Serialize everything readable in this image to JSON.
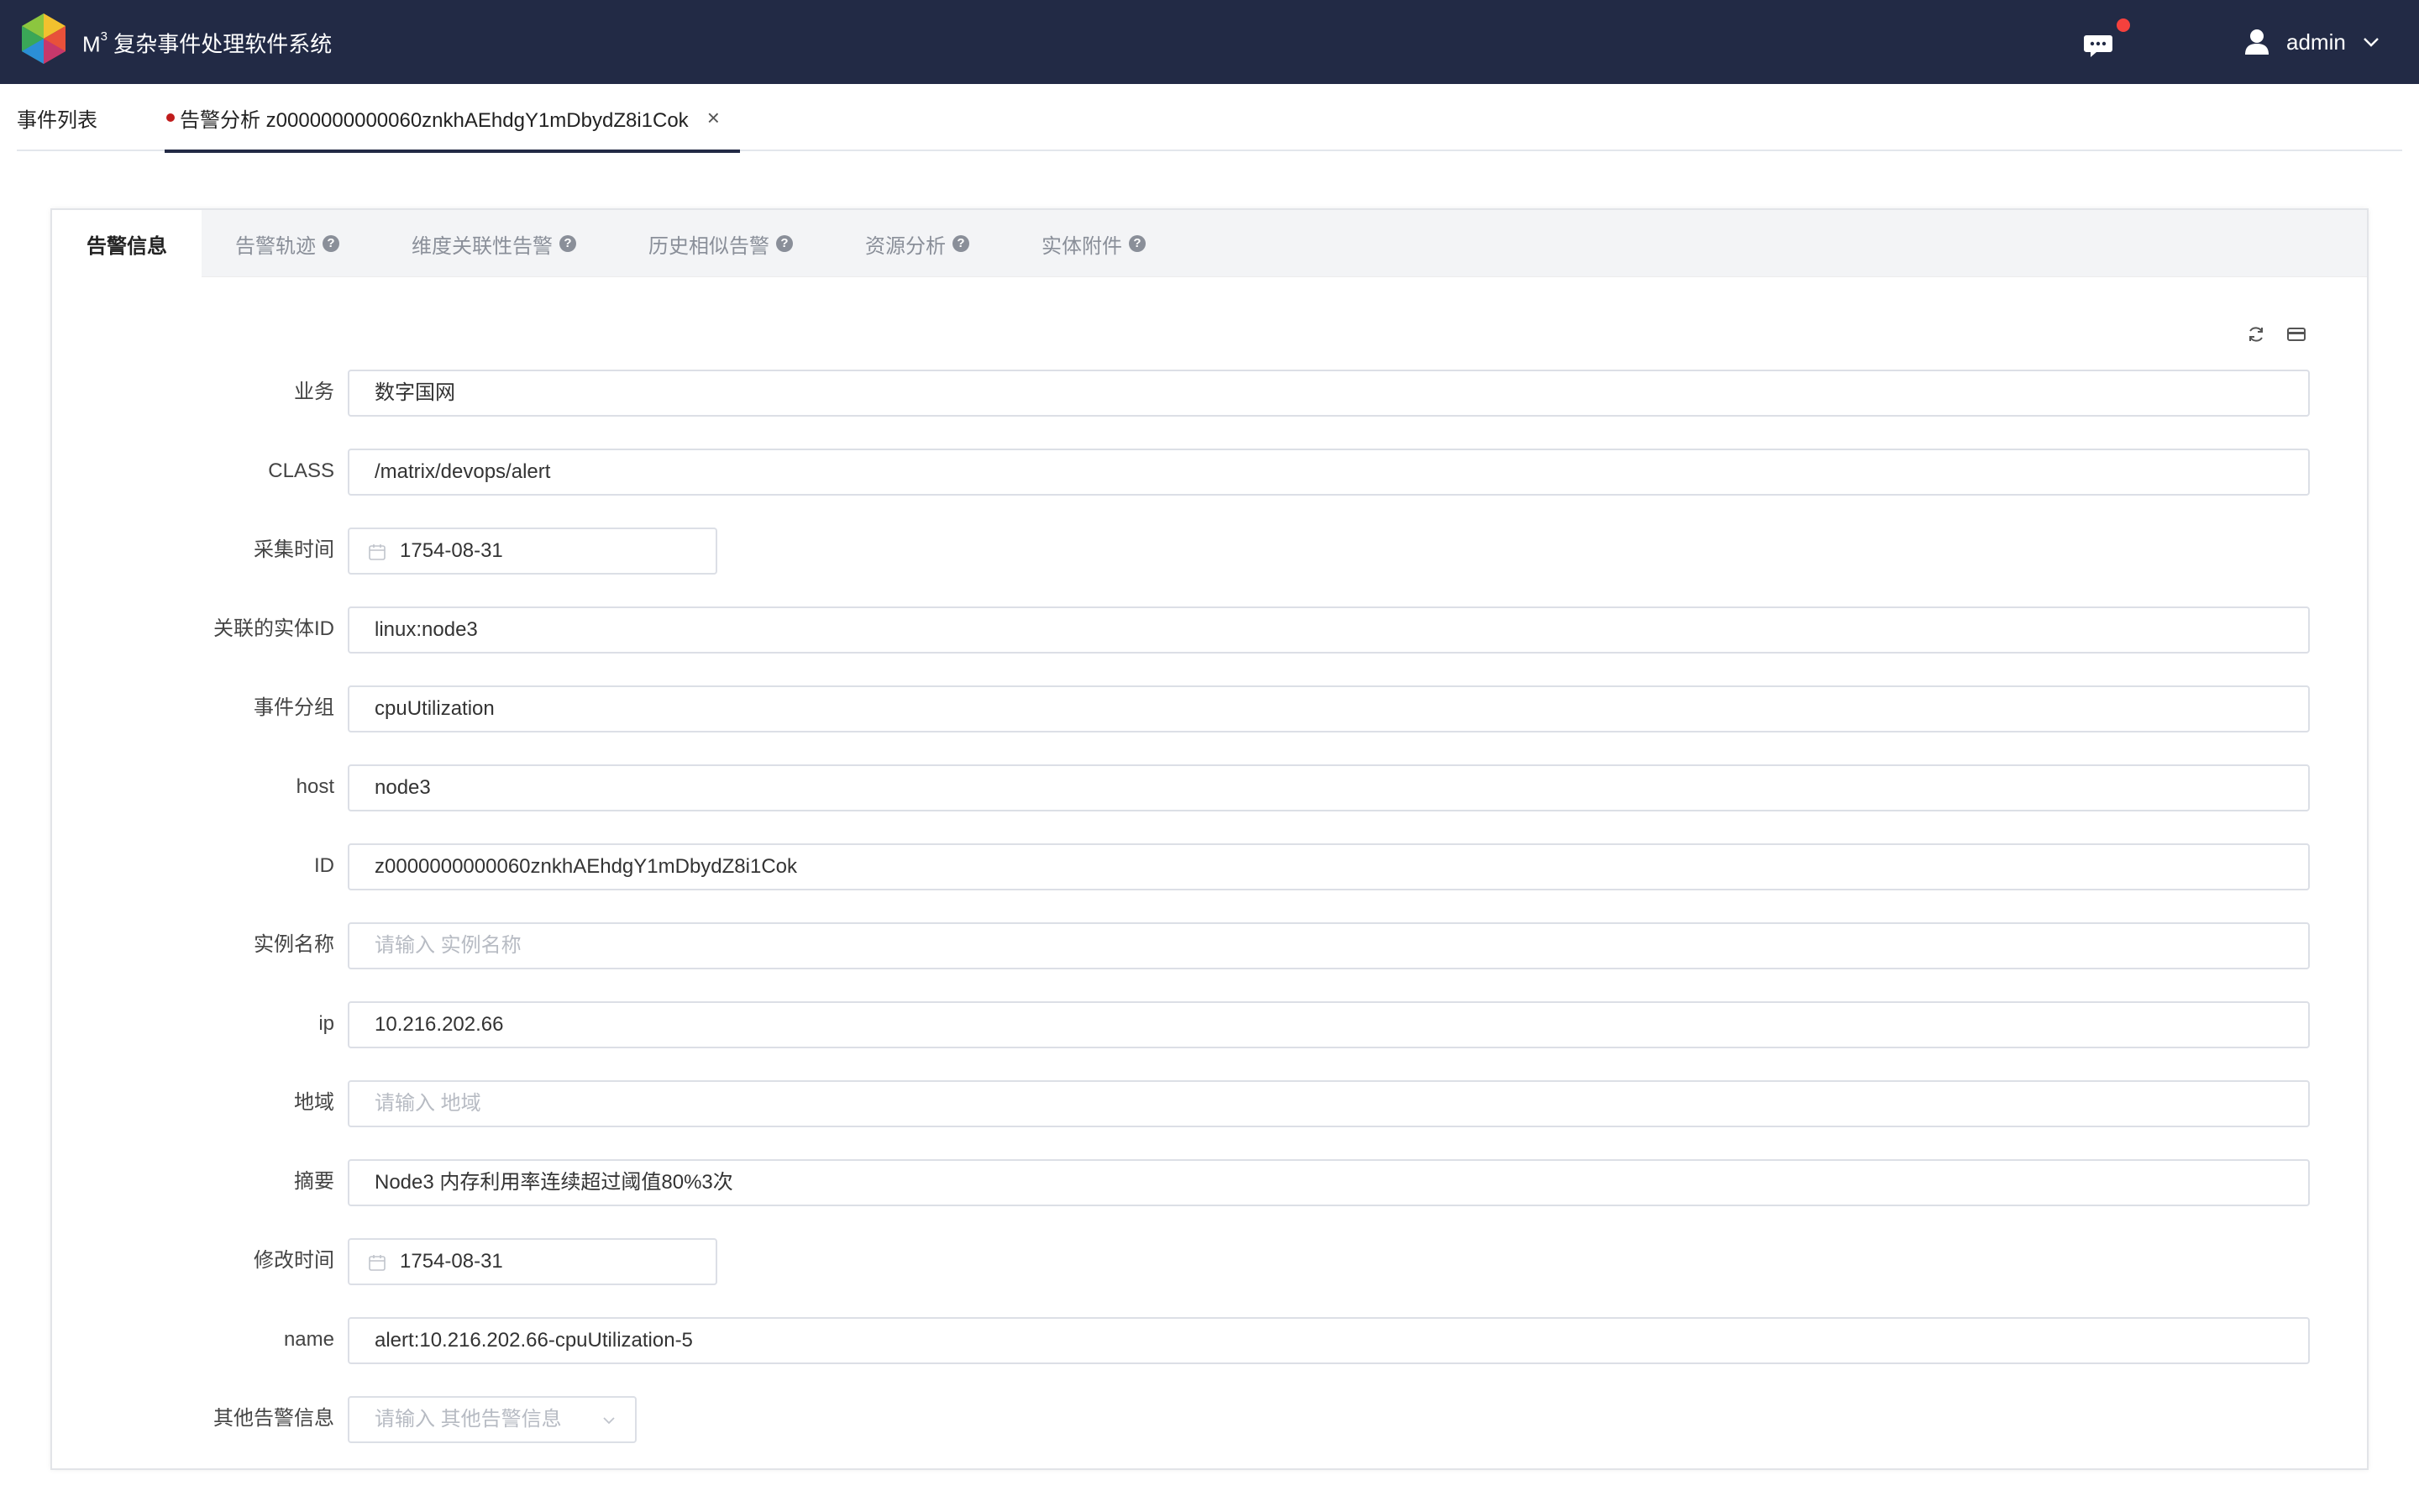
{
  "app": {
    "title_main": "M",
    "title_sup": "3",
    "title_rest": " 复杂事件处理软件系统",
    "user": "admin"
  },
  "pagetabs": {
    "list": "事件列表",
    "detail": "告警分析 z0000000000060znkhAEhdgY1mDbydZ8i1Cok"
  },
  "subtabs": [
    "告警信息",
    "告警轨迹",
    "维度关联性告警",
    "历史相似告警",
    "资源分析",
    "实体附件"
  ],
  "form": {
    "business": {
      "label": "业务",
      "value": "数字国网"
    },
    "class": {
      "label": "CLASS",
      "value": "/matrix/devops/alert"
    },
    "collect_time": {
      "label": "采集时间",
      "value": "1754-08-31"
    },
    "entity_id": {
      "label": "关联的实体ID",
      "value": "linux:node3"
    },
    "event_group": {
      "label": "事件分组",
      "value": "cpuUtilization"
    },
    "host": {
      "label": "host",
      "value": "node3"
    },
    "id": {
      "label": "ID",
      "value": "z0000000000060znkhAEhdgY1mDbydZ8i1Cok"
    },
    "instance_name": {
      "label": "实例名称",
      "placeholder": "请输入 实例名称"
    },
    "ip": {
      "label": "ip",
      "value": "10.216.202.66"
    },
    "region": {
      "label": "地域",
      "placeholder": "请输入 地域"
    },
    "summary": {
      "label": "摘要",
      "value": "Node3 内存利用率连续超过阈值80%3次"
    },
    "modify_time": {
      "label": "修改时间",
      "value": "1754-08-31"
    },
    "name": {
      "label": "name",
      "value": "alert:10.216.202.66-cpuUtilization-5"
    },
    "other_alerts": {
      "label": "其他告警信息",
      "placeholder": "请输入 其他告警信息"
    }
  },
  "colors": {
    "topbar": "#222a45",
    "badge": "#f5413d",
    "tab_dot": "#c01c1c"
  },
  "icons": [
    "app-logo-icon",
    "message-icon",
    "user-icon",
    "chevron-down-icon",
    "close-icon",
    "help-icon",
    "refresh-icon",
    "card-icon",
    "calendar-icon"
  ]
}
